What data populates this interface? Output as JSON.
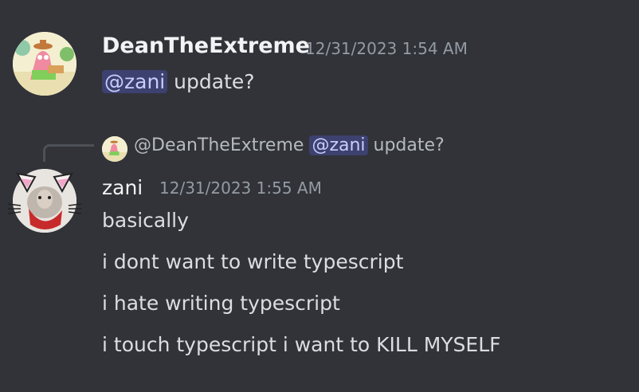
{
  "messages": [
    {
      "author": "DeanTheExtreme",
      "timestamp": "12/31/2023 1:54 AM",
      "mention": "@zani",
      "text": " update?"
    },
    {
      "author": "zani",
      "timestamp": "12/31/2023 1:55 AM",
      "reply": {
        "author": "@DeanTheExtreme",
        "mention": "@zani",
        "text": " update?"
      },
      "lines": [
        "basically",
        "i dont want to write typescript",
        "i hate writing typescript",
        "i touch typescript i want to KILL MYSELF"
      ]
    }
  ]
}
